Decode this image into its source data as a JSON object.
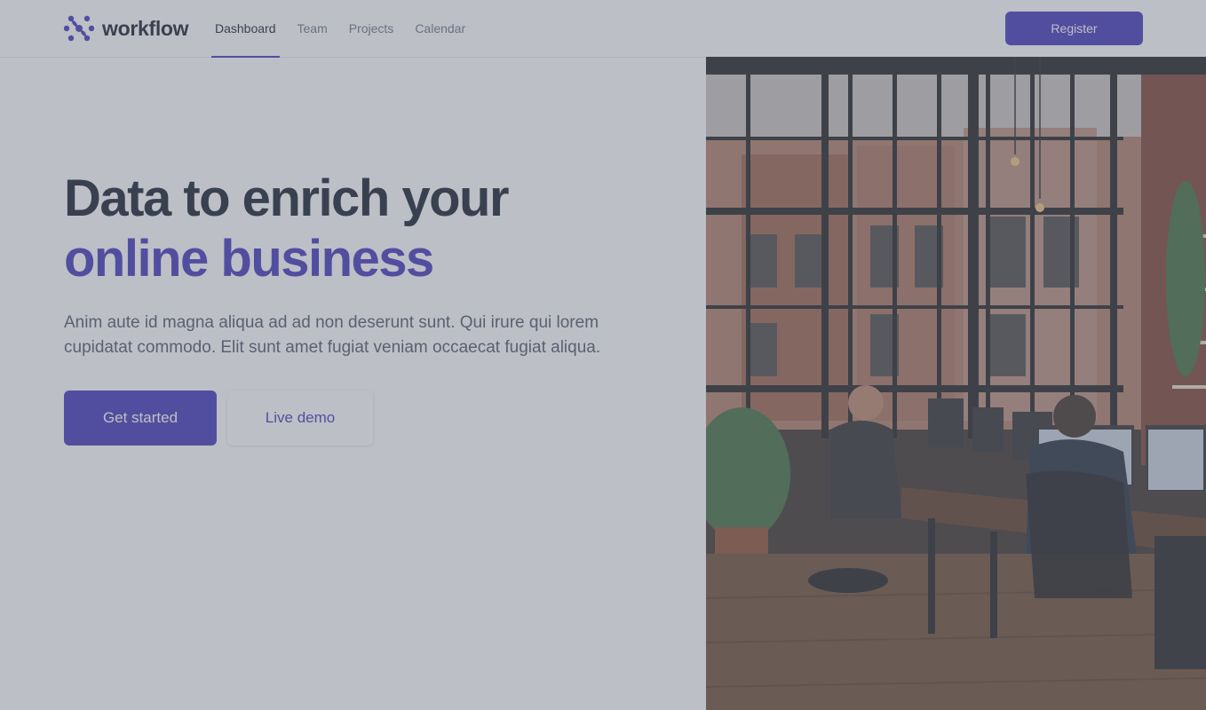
{
  "theme": {
    "accent": "#3f32b8",
    "overlay": "rgba(107,114,128,0.45)"
  },
  "brand": {
    "name": "workflow",
    "icon": "workflow-logo-icon"
  },
  "nav": {
    "tabs": [
      {
        "label": "Dashboard",
        "active": true
      },
      {
        "label": "Team",
        "active": false
      },
      {
        "label": "Projects",
        "active": false
      },
      {
        "label": "Calendar",
        "active": false
      }
    ]
  },
  "header": {
    "register_label": "Register"
  },
  "hero": {
    "title_line1": "Data to enrich your",
    "title_line2": "online business",
    "subtitle": "Anim aute id magna aliqua ad ad non deserunt sunt. Qui irure qui lorem cupidatat commodo. Elit sunt amet fugiat veniam occaecat fugiat aliqua.",
    "primary_cta": "Get started",
    "secondary_cta": "Live demo"
  },
  "photo": {
    "subject": "office-photo"
  }
}
